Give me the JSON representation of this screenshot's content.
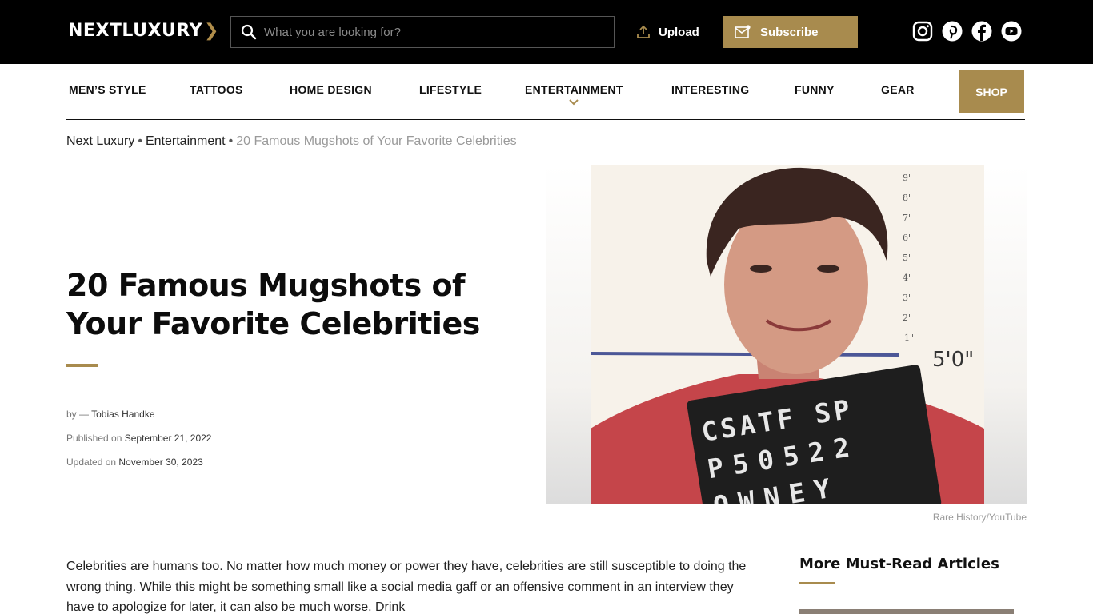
{
  "header": {
    "logo_text": "NEXTLUXURY",
    "logo_chevron": "❯",
    "search_placeholder": "What you are looking for?",
    "upload_label": "Upload",
    "subscribe_label": "Subscribe",
    "social_icons": [
      "instagram-icon",
      "pinterest-icon",
      "facebook-icon",
      "youtube-icon"
    ]
  },
  "nav": {
    "items": [
      {
        "label": "MEN’S STYLE"
      },
      {
        "label": "TATTOOS"
      },
      {
        "label": "HOME DESIGN"
      },
      {
        "label": "LIFESTYLE"
      },
      {
        "label": "ENTERTAINMENT"
      },
      {
        "label": "INTERESTING"
      },
      {
        "label": "FUNNY"
      },
      {
        "label": "GEAR"
      }
    ],
    "shop_label": "SHOP"
  },
  "breadcrumb": {
    "items": [
      "Next Luxury",
      "Entertainment"
    ],
    "separator": "•",
    "current": "20 Famous Mugshots of Your Favorite Celebrities"
  },
  "article": {
    "title": "20 Famous Mugshots of Your Favorite Celebrities",
    "author_prefix": "by — ",
    "author": "Tobias Handke",
    "published_prefix": "Published on ",
    "published": "September 21, 2022",
    "updated_prefix": "Updated on ",
    "updated": "November 30, 2023",
    "image_credit": "Rare History/YouTube",
    "mugshot_board": {
      "line1": "CSATF   SP",
      "line2": "P50522",
      "line3": "OWNEY"
    },
    "height_chart": {
      "marks": [
        "9\"",
        "8\"",
        "7\"",
        "6\"",
        "5\"",
        "4\"",
        "3\"",
        "2\"",
        "1\""
      ],
      "height_label": "5'0\""
    },
    "intro": "Celebrities are humans too. No matter how much money or power they have, celebrities are still susceptible to doing the wrong thing. While this might be something small like a social media gaff or an offensive comment in an interview they have to apologize for later, it can also be much worse. Drink"
  },
  "sidebar": {
    "title": "More Must-Read Articles"
  },
  "colors": {
    "accent_gold": "#a88b4e",
    "header_bg": "#000000"
  }
}
